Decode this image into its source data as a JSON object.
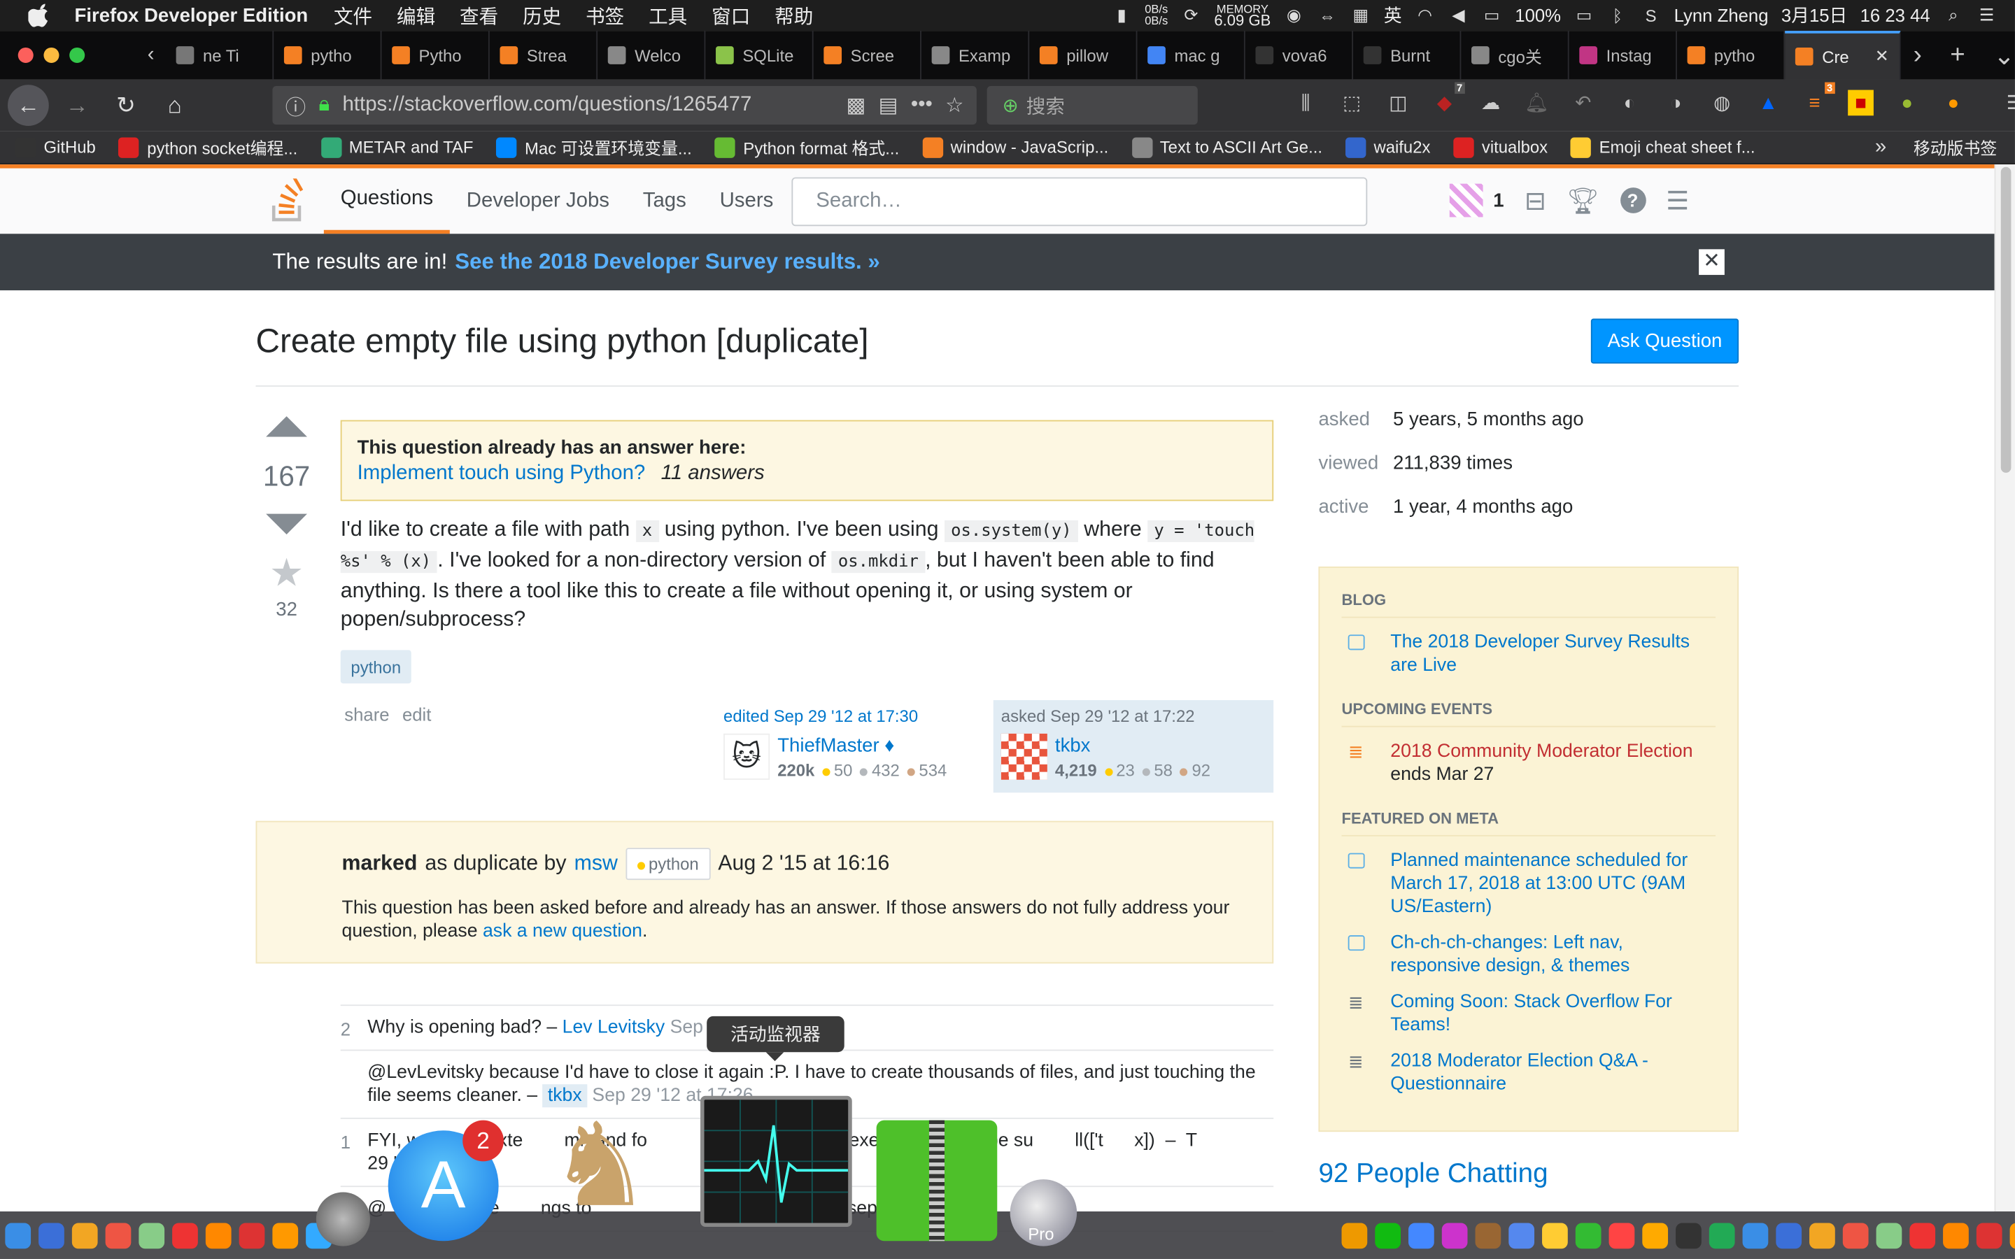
{
  "menubar": {
    "app_name": "Firefox Developer Edition",
    "menus": [
      "文件",
      "编辑",
      "查看",
      "历史",
      "书签",
      "工具",
      "窗口",
      "帮助"
    ],
    "net_up": "0B/s",
    "net_down": "0B/s",
    "memory_label": "MEMORY",
    "memory_value": "6.09 GB",
    "input_method": "英",
    "battery": "100%",
    "user": "Lynn Zheng",
    "date": "3月15日",
    "time": "16 23 44"
  },
  "tabs": [
    {
      "label": "ne Ti",
      "color": "#777"
    },
    {
      "label": "pytho",
      "color": "#f48024"
    },
    {
      "label": "Pytho",
      "color": "#f48024"
    },
    {
      "label": "Strea",
      "color": "#f48024"
    },
    {
      "label": "Welco",
      "color": "#888"
    },
    {
      "label": "SQLite",
      "color": "#8bc34a"
    },
    {
      "label": "Scree",
      "color": "#f48024"
    },
    {
      "label": "Examp",
      "color": "#888"
    },
    {
      "label": "pillow",
      "color": "#f48024"
    },
    {
      "label": "mac g",
      "color": "#4285f4"
    },
    {
      "label": "vova6",
      "color": "#333"
    },
    {
      "label": "Burnt",
      "color": "#333"
    },
    {
      "label": "cgo关",
      "color": "#888"
    },
    {
      "label": "Instag",
      "color": "#c13584"
    },
    {
      "label": "pytho",
      "color": "#f48024"
    },
    {
      "label": "Cre",
      "color": "#f48024",
      "active": true
    }
  ],
  "nav": {
    "url": "https://stackoverflow.com/questions/1265477",
    "search_placeholder": "搜索",
    "badge_count": "7",
    "badge_count2": "3"
  },
  "bookmarks": [
    {
      "label": "GitHub",
      "color": "#333"
    },
    {
      "label": "python socket编程...",
      "color": "#d22"
    },
    {
      "label": "METAR and TAF",
      "color": "#3a7"
    },
    {
      "label": "Mac 可设置环境变量...",
      "color": "#08f"
    },
    {
      "label": "Python format 格式...",
      "color": "#6b3"
    },
    {
      "label": "window - JavaScrip...",
      "color": "#f48024"
    },
    {
      "label": "Text to ASCII Art Ge...",
      "color": "#888"
    },
    {
      "label": "waifu2x",
      "color": "#36c"
    },
    {
      "label": "vitualbox",
      "color": "#d22"
    },
    {
      "label": "Emoji cheat sheet f...",
      "color": "#fc3"
    }
  ],
  "bookmarks_mobile": "移动版书签",
  "so_nav": {
    "questions": "Questions",
    "jobs": "Developer Jobs",
    "tags": "Tags",
    "users": "Users",
    "search_placeholder": "Search…",
    "reputation": "1"
  },
  "announcement": {
    "text": "The results are in!",
    "link": "See the 2018 Developer Survey results. »"
  },
  "question": {
    "title": "Create empty file using python [duplicate]",
    "ask_button": "Ask Question",
    "votes": "167",
    "favorites": "32",
    "dup_header": "This question already has an answer here:",
    "dup_link": "Implement touch using Python?",
    "dup_answers": "11 answers",
    "body_1": "I'd like to create a file with path",
    "code_x": "x",
    "body_2": "using python. I've been using",
    "code_system": "os.system(y)",
    "body_3": "where",
    "code_y": "y = 'touch %s' % (x)",
    "body_4": ". I've looked for a non-directory version of",
    "code_mkdir": "os.mkdir",
    "body_5": ", but I haven't been able to find anything. Is there a tool like this to create a file without opening it, or using system or popen/subprocess?",
    "tag": "python",
    "share": "share",
    "edit": "edit"
  },
  "edited": {
    "label": "edited Sep 29 '12 at 17:30",
    "user": "ThiefMaster ♦",
    "rep": "220k",
    "gold": "50",
    "silver": "432",
    "bronze": "534"
  },
  "asked": {
    "label": "asked Sep 29 '12 at 17:22",
    "user": "tkbx",
    "rep": "4,219",
    "gold": "23",
    "silver": "58",
    "bronze": "92"
  },
  "marked": {
    "bold": "marked",
    "text": "as duplicate by",
    "user": "msw",
    "tag": "python",
    "date": "Aug 2 '15 at 16:16",
    "note_1": "This question has been asked before and already has an answer. If those answers do not fully address your question, please",
    "note_link": "ask a new question",
    "note_end": "."
  },
  "comments": [
    {
      "score": "2",
      "text": "Why is opening bad? –",
      "user": "Lev Levitsky",
      "date": "Sep 2"
    },
    {
      "score": "",
      "text": "@LevLevitsky because I'd have to close it again :P. I have to create thousands of files, and just touching the file seems cleaner. –",
      "user": "tkbx",
      "date": "Sep 29 '12 at 17:26"
    },
    {
      "score": "1",
      "text": "FYI, w        an exte        mmand fo                 , th              o execute it would be su        ll(['t      x])  –  T          29 '",
      "user": "",
      "date": ""
    },
    {
      "score": "",
      "text": "@          can me        ngs to                      exa             etely separate process",
      "user": "",
      "date": ""
    }
  ],
  "sidebar": {
    "asked_k": "asked",
    "asked_v": "5 years, 5 months ago",
    "viewed_k": "viewed",
    "viewed_v": "211,839 times",
    "active_k": "active",
    "active_v": "1 year, 4 months ago",
    "blog_head": "BLOG",
    "blog_1": "The 2018 Developer Survey Results are Live",
    "events_head": "UPCOMING EVENTS",
    "event_1": "2018 Community Moderator Election",
    "event_1_sub": "ends Mar 27",
    "meta_head": "FEATURED ON META",
    "meta_1": "Planned maintenance scheduled for March 17, 2018 at 13:00 UTC (9AM US/Eastern)",
    "meta_2": "Ch-ch-ch-changes: Left nav, responsive design, & themes",
    "meta_3": "Coming Soon: Stack Overflow For Teams!",
    "meta_4": "2018 Moderator Election Q&A - Questionnaire",
    "chatting": "92 People Chatting"
  },
  "dock": {
    "tooltip": "活动监视器",
    "appstore_badge": "2",
    "pro_label": "Pro"
  },
  "colors": {
    "so_orange": "#f48024",
    "so_link": "#0077cc",
    "ask_button": "#0095ff",
    "notice_bg": "#fdf7e2",
    "announce_bg": "#3b4045"
  }
}
